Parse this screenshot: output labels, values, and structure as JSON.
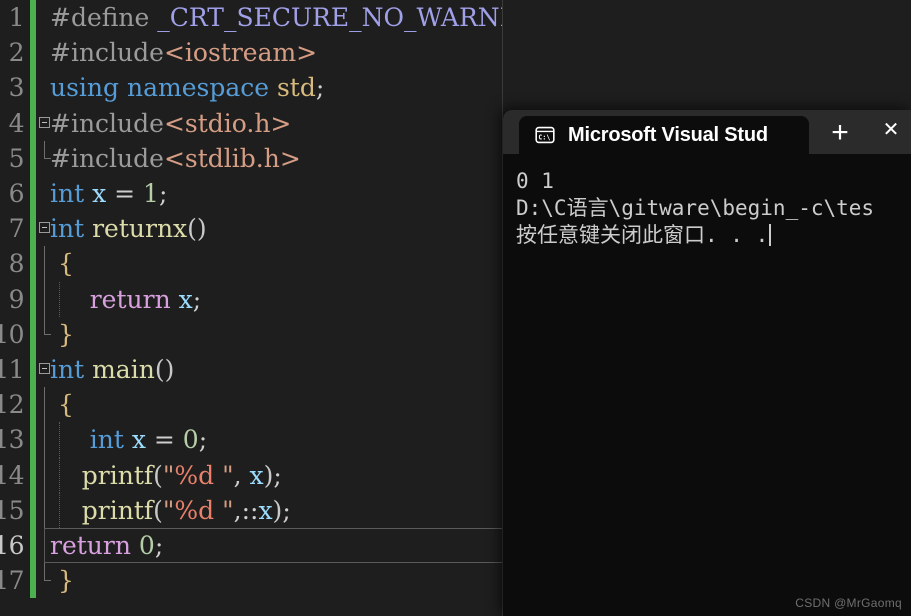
{
  "editor": {
    "name": "visual-studio-code-editor",
    "theme_background": "#1e1e1e",
    "change_bar_color": "#4caf50",
    "lines": [
      {
        "number": "1",
        "fold": false,
        "guides": 0,
        "tokens": [
          {
            "t": "#define ",
            "c": "c-pp"
          },
          {
            "t": "_CRT_SECURE_NO_WARNINGS",
            "c": "c-macro"
          }
        ]
      },
      {
        "number": "2",
        "fold": false,
        "guides": 0,
        "tokens": [
          {
            "t": "#include",
            "c": "c-pp"
          },
          {
            "t": "<iostream>",
            "c": "c-hdr"
          }
        ]
      },
      {
        "number": "3",
        "fold": false,
        "guides": 0,
        "tokens": [
          {
            "t": "using namespace ",
            "c": "c-kw"
          },
          {
            "t": "std",
            "c": "c-ns"
          },
          {
            "t": ";",
            "c": "c-punct"
          }
        ]
      },
      {
        "number": "4",
        "fold": true,
        "guides": 0,
        "tokens": [
          {
            "t": "#include",
            "c": "c-pp"
          },
          {
            "t": "<stdio.h>",
            "c": "c-hdr"
          }
        ]
      },
      {
        "number": "5",
        "fold": false,
        "foldline": "end",
        "guides": 0,
        "tokens": [
          {
            "t": "#include",
            "c": "c-pp"
          },
          {
            "t": "<stdlib.h>",
            "c": "c-hdr"
          }
        ]
      },
      {
        "number": "6",
        "fold": false,
        "guides": 0,
        "tokens": [
          {
            "t": "int ",
            "c": "c-type"
          },
          {
            "t": "x ",
            "c": "c-ident"
          },
          {
            "t": "= ",
            "c": "c-punct"
          },
          {
            "t": "1",
            "c": "c-num"
          },
          {
            "t": ";",
            "c": "c-punct"
          }
        ]
      },
      {
        "number": "7",
        "fold": true,
        "guides": 0,
        "tokens": [
          {
            "t": "int ",
            "c": "c-type"
          },
          {
            "t": "returnx",
            "c": "c-fn"
          },
          {
            "t": "()",
            "c": "c-paren"
          }
        ]
      },
      {
        "number": "8",
        "fold": false,
        "foldline": "mid",
        "guides": 0,
        "tokens": [
          {
            "t": " {",
            "c": "c-brace"
          }
        ]
      },
      {
        "number": "9",
        "fold": false,
        "foldline": "mid",
        "guides": 1,
        "tokens": [
          {
            "t": "     ",
            "c": "c-punct"
          },
          {
            "t": "return ",
            "c": "c-ctrl"
          },
          {
            "t": "x",
            "c": "c-ident"
          },
          {
            "t": ";",
            "c": "c-punct"
          }
        ]
      },
      {
        "number": "10",
        "fold": false,
        "foldline": "end",
        "guides": 0,
        "tokens": [
          {
            "t": " }",
            "c": "c-brace"
          }
        ]
      },
      {
        "number": "11",
        "fold": true,
        "guides": 0,
        "tokens": [
          {
            "t": "int ",
            "c": "c-type"
          },
          {
            "t": "main",
            "c": "c-fn"
          },
          {
            "t": "()",
            "c": "c-paren"
          }
        ]
      },
      {
        "number": "12",
        "fold": false,
        "foldline": "mid",
        "guides": 0,
        "tokens": [
          {
            "t": " {",
            "c": "c-brace"
          }
        ]
      },
      {
        "number": "13",
        "fold": false,
        "foldline": "mid",
        "guides": 1,
        "tokens": [
          {
            "t": "     ",
            "c": "c-punct"
          },
          {
            "t": "int ",
            "c": "c-type"
          },
          {
            "t": "x ",
            "c": "c-ident"
          },
          {
            "t": "= ",
            "c": "c-punct"
          },
          {
            "t": "0",
            "c": "c-num"
          },
          {
            "t": ";",
            "c": "c-punct"
          }
        ]
      },
      {
        "number": "14",
        "fold": false,
        "foldline": "mid",
        "guides": 1,
        "tokens": [
          {
            "t": "    ",
            "c": "c-punct"
          },
          {
            "t": "printf",
            "c": "c-fn"
          },
          {
            "t": "(",
            "c": "c-paren"
          },
          {
            "t": "\"",
            "c": "c-str"
          },
          {
            "t": "%d",
            "c": "c-fmt"
          },
          {
            "t": " \"",
            "c": "c-str"
          },
          {
            "t": ", ",
            "c": "c-punct"
          },
          {
            "t": "x",
            "c": "c-ident"
          },
          {
            "t": ")",
            "c": "c-paren"
          },
          {
            "t": ";",
            "c": "c-punct"
          }
        ]
      },
      {
        "number": "15",
        "fold": false,
        "foldline": "mid",
        "guides": 1,
        "tokens": [
          {
            "t": "    ",
            "c": "c-punct"
          },
          {
            "t": "printf",
            "c": "c-fn"
          },
          {
            "t": "(",
            "c": "c-paren"
          },
          {
            "t": "\"",
            "c": "c-str"
          },
          {
            "t": "%d",
            "c": "c-fmt"
          },
          {
            "t": " \"",
            "c": "c-str"
          },
          {
            "t": ",::",
            "c": "c-punct"
          },
          {
            "t": "x",
            "c": "c-ident"
          },
          {
            "t": ")",
            "c": "c-paren"
          },
          {
            "t": ";",
            "c": "c-punct"
          }
        ]
      },
      {
        "number": "16",
        "fold": false,
        "foldline": "mid",
        "current": true,
        "guides": 0,
        "tokens": [
          {
            "t": "return ",
            "c": "c-ctrl"
          },
          {
            "t": "0",
            "c": "c-num"
          },
          {
            "t": ";",
            "c": "c-punct"
          }
        ]
      },
      {
        "number": "17",
        "fold": false,
        "foldline": "end",
        "guides": 0,
        "tokens": [
          {
            "t": " }",
            "c": "c-brace"
          }
        ]
      }
    ]
  },
  "console": {
    "name": "windows-terminal",
    "tab": {
      "icon": "console-cmd-icon",
      "title": "Microsoft Visual Stud",
      "close_label": "✕"
    },
    "new_tab_label": "+",
    "output": [
      "0 1",
      "D:\\C语言\\gitware\\begin_-c\\tes",
      "按任意键关闭此窗口. . ."
    ]
  },
  "watermark": {
    "text": "CSDN @MrGaomq"
  }
}
